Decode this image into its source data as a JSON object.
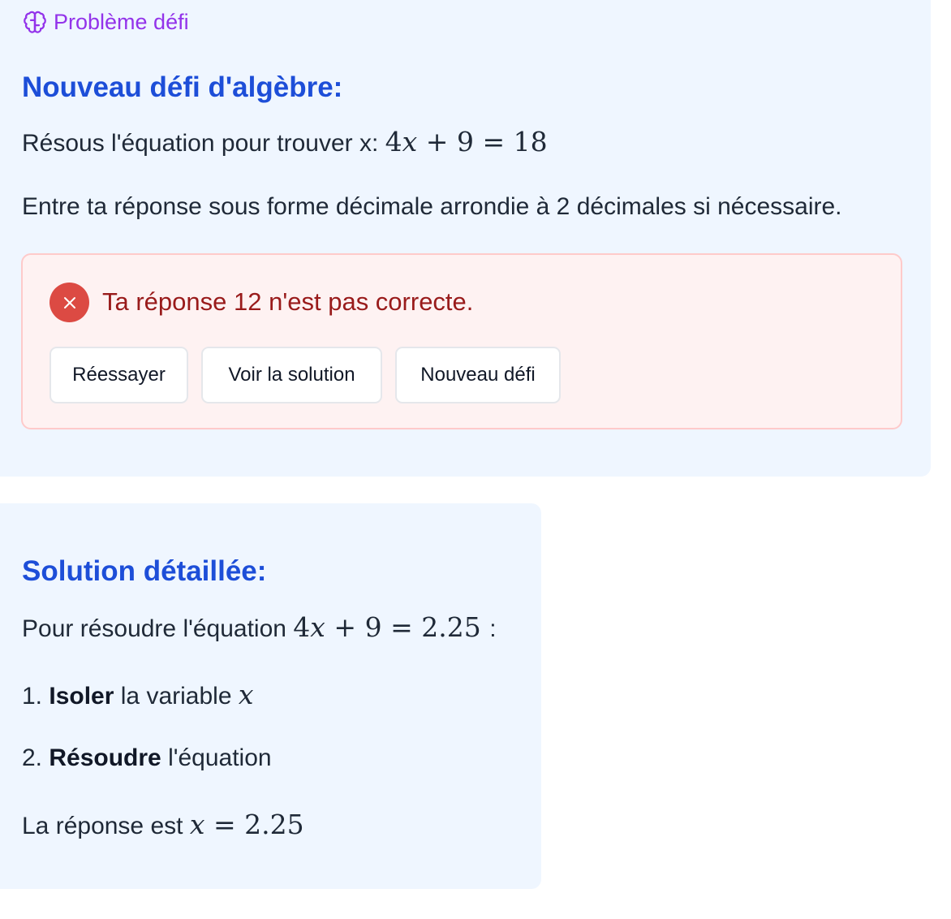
{
  "challenge": {
    "tag_label": "Problème défi",
    "tag_icon": "brain-icon",
    "title": "Nouveau défi d'algèbre:",
    "prompt_prefix": "Résous l'équation pour trouver x:",
    "equation": {
      "coef": "4",
      "var": "x",
      "plus": "+",
      "const": "9",
      "eq": "=",
      "rhs": "18"
    },
    "instruction": "Entre ta réponse sous forme décimale arrondie à 2 décimales si nécessaire."
  },
  "feedback": {
    "icon": "close-icon",
    "message": "Ta réponse 12 n'est pas correcte.",
    "buttons": {
      "retry": "Réessayer",
      "show_solution": "Voir la solution",
      "new_challenge": "Nouveau défi"
    }
  },
  "solution": {
    "title": "Solution détaillée:",
    "intro_prefix": "Pour résoudre l'équation",
    "intro_equation": {
      "coef": "4",
      "var": "x",
      "plus": "+",
      "const": "9",
      "eq": "=",
      "rhs": "2.25"
    },
    "intro_suffix": ":",
    "step1": {
      "number": "1.",
      "bold": "Isoler",
      "text": "la variable",
      "var": "x"
    },
    "step2": {
      "number": "2.",
      "bold": "Résoudre",
      "text": "l'équation"
    },
    "answer": {
      "prefix": "La réponse est",
      "var": "x",
      "eq": "=",
      "value": "2.25"
    }
  },
  "colors": {
    "card_bg": "#eff6ff",
    "title_blue": "#1d4ed8",
    "tag_purple": "#9333ea",
    "error_bg": "#fef2f2",
    "error_border": "#fecaca",
    "error_text": "#991b1b",
    "error_icon": "#dc4a43"
  }
}
